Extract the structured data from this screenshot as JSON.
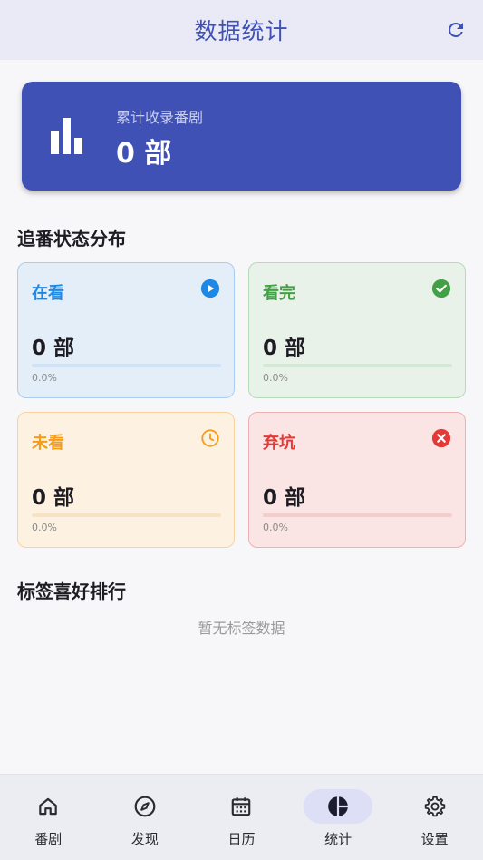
{
  "app_bar": {
    "title": "数据统计",
    "refresh_icon": "refresh-icon"
  },
  "total": {
    "label": "累计收录番剧",
    "value": "0 部",
    "icon": "bar-chart-icon"
  },
  "distribution": {
    "title": "追番状态分布",
    "cards": [
      {
        "label": "在看",
        "value": "0 部",
        "percent_text": "0.0%",
        "fraction": 0.0,
        "icon": "play-circle-icon",
        "accent": "#1e88e5",
        "bg": "#e3eef9",
        "border": "#a9cdf2",
        "track": "#cfe2f6"
      },
      {
        "label": "看完",
        "value": "0 部",
        "percent_text": "0.0%",
        "fraction": 0.0,
        "icon": "check-circle-icon",
        "accent": "#43a047",
        "bg": "#e8f2e9",
        "border": "#b4dbb6",
        "track": "#d3e8d4"
      },
      {
        "label": "未看",
        "value": "0 部",
        "percent_text": "0.0%",
        "fraction": 0.0,
        "icon": "clock-icon",
        "accent": "#f59c1a",
        "bg": "#fdf1e2",
        "border": "#f9d29f",
        "track": "#f8e2c4"
      },
      {
        "label": "弃坑",
        "value": "0 部",
        "percent_text": "0.0%",
        "fraction": 0.0,
        "icon": "cancel-circle-icon",
        "accent": "#e53935",
        "bg": "#fae4e4",
        "border": "#f0b0b0",
        "track": "#f3cccc"
      }
    ]
  },
  "tags": {
    "title": "标签喜好排行",
    "empty_text": "暂无标签数据"
  },
  "nav": {
    "active": "统计",
    "items": [
      {
        "label": "番剧",
        "icon": "home-icon"
      },
      {
        "label": "发现",
        "icon": "compass-icon"
      },
      {
        "label": "日历",
        "icon": "calendar-icon"
      },
      {
        "label": "统计",
        "icon": "pie-chart-icon"
      },
      {
        "label": "设置",
        "icon": "gear-icon"
      }
    ]
  }
}
